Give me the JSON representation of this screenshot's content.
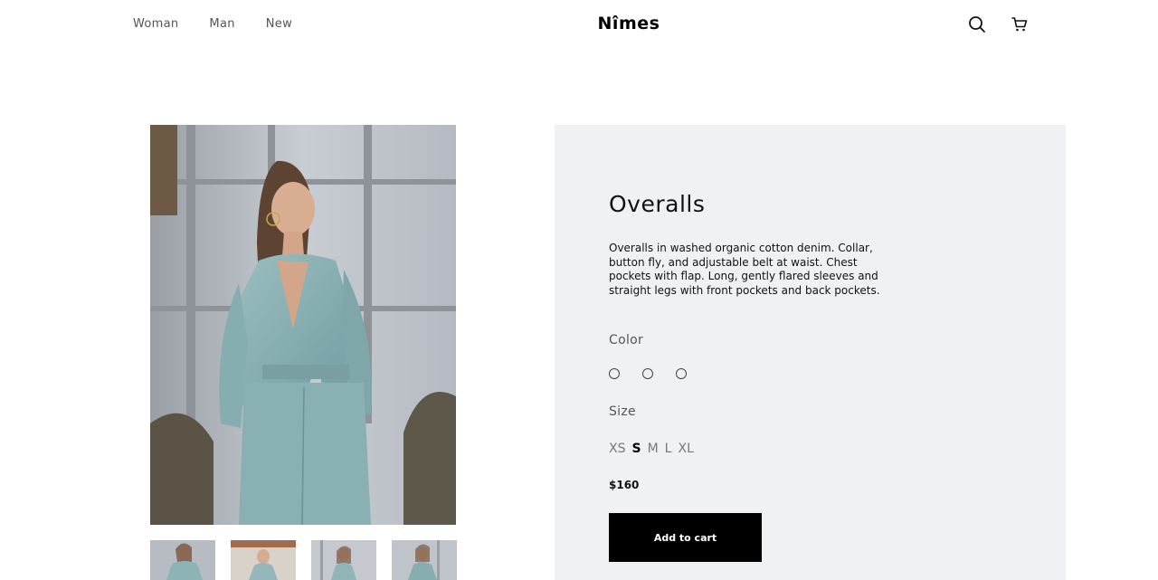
{
  "header": {
    "nav": [
      "Woman",
      "Man",
      "New"
    ],
    "logo": "Nîmes",
    "icons": [
      "search-icon",
      "cart-icon"
    ]
  },
  "product": {
    "title": "Overalls",
    "description": "Overalls in washed organic cotton denim. Collar, button fly, and adjustable belt at waist. Chest pockets with flap. Long, gently flared sleeves and straight legs with front pockets and back pockets.",
    "color_label": "Color",
    "size_label": "Size",
    "sizes": [
      "XS",
      "S",
      "M",
      "L",
      "XL"
    ],
    "selected_size": "S",
    "price": "$160",
    "add_to_cart": "Add to cart"
  },
  "colors": {
    "panel_bg": "#f0f1f3",
    "button_bg": "#000000",
    "denim": "#8fb3b5"
  }
}
